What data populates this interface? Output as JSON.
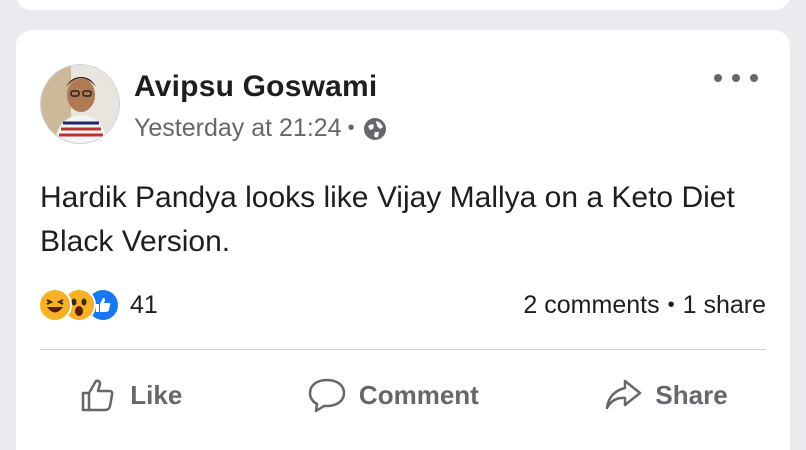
{
  "post": {
    "author_name": "Avipsu Goswami",
    "timestamp": "Yesterday at 21:24",
    "separator": "•",
    "privacy_icon": "globe-icon",
    "body": "Hardik Pandya looks like Vijay Mallya on a Keto Diet Black Version.",
    "more_icon": "more-options-icon"
  },
  "engagement": {
    "reaction_icons": [
      "haha-emoji-icon",
      "wow-emoji-icon",
      "like-emoji-icon"
    ],
    "reaction_count": "41",
    "comments": "2 comments",
    "separator": "•",
    "shares": "1 share"
  },
  "actions": {
    "like_label": "Like",
    "comment_label": "Comment",
    "share_label": "Share"
  },
  "colors": {
    "background": "#e9ebee",
    "card": "#ffffff",
    "text_primary": "#1c1e21",
    "text_secondary": "#65676b",
    "like_blue": "#1877f2",
    "reaction_yellow": "#f7b125"
  }
}
